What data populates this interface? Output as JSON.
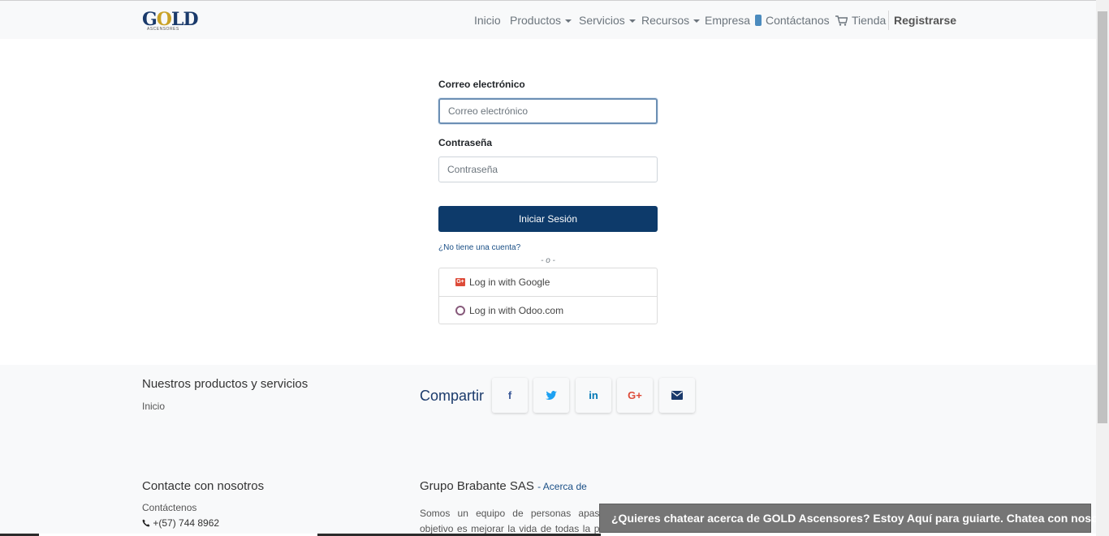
{
  "brand": {
    "logo_text_g": "G",
    "logo_text_o": "O",
    "logo_text_ld": "LD",
    "logo_sub": "ASCENSORES"
  },
  "nav": {
    "items": [
      {
        "label": "Inicio"
      },
      {
        "label": "Productos"
      },
      {
        "label": "Servicios"
      },
      {
        "label": "Recursos"
      },
      {
        "label": "Empresa"
      },
      {
        "label": "Contáctanos"
      },
      {
        "label": "Tienda"
      },
      {
        "label": "Registrarse"
      }
    ]
  },
  "login": {
    "email_label": "Correo electrónico",
    "email_placeholder": "Correo electrónico",
    "password_label": "Contraseña",
    "password_placeholder": "Contraseña",
    "submit_label": "Iniciar Sesión",
    "signup_link": "¿No tiene una cuenta?",
    "or_text": "- o -",
    "oauth": [
      {
        "label": "Log in with Google",
        "icon": "google-plus-icon"
      },
      {
        "label": "Log in with Odoo.com",
        "icon": "odoo-icon"
      }
    ]
  },
  "footer": {
    "products_title": "Nuestros productos y servicios",
    "products_links": [
      "Inicio"
    ],
    "share_title": "Compartir",
    "share_buttons": [
      {
        "glyph": "f",
        "icon": "facebook-icon",
        "color": "#3b5998"
      },
      {
        "glyph": "🐦",
        "icon": "twitter-icon",
        "color": "#1da1f2"
      },
      {
        "glyph": "in",
        "icon": "linkedin-icon",
        "color": "#0077b5"
      },
      {
        "glyph": "G+",
        "icon": "google-plus-icon",
        "color": "#dd4b39"
      },
      {
        "glyph": "✉",
        "icon": "envelope-icon",
        "color": "#1a3a6b"
      }
    ],
    "contact_title": "Contacte con nosotros",
    "contact_link": "Contáctenos",
    "contact_phone": "+(57) 744 8962",
    "company_title": "Grupo Brabante SAS",
    "company_about_link": "- Acerca de",
    "company_text": "Somos un equipo de personas apasionadas. Nuestro objetivo es mejorar la vida de todas la personas mediante la"
  },
  "chat": {
    "text": "¿Quieres chatear acerca de GOLD Ascensores? Estoy Aquí para guiarte. Chatea con nosotros."
  }
}
